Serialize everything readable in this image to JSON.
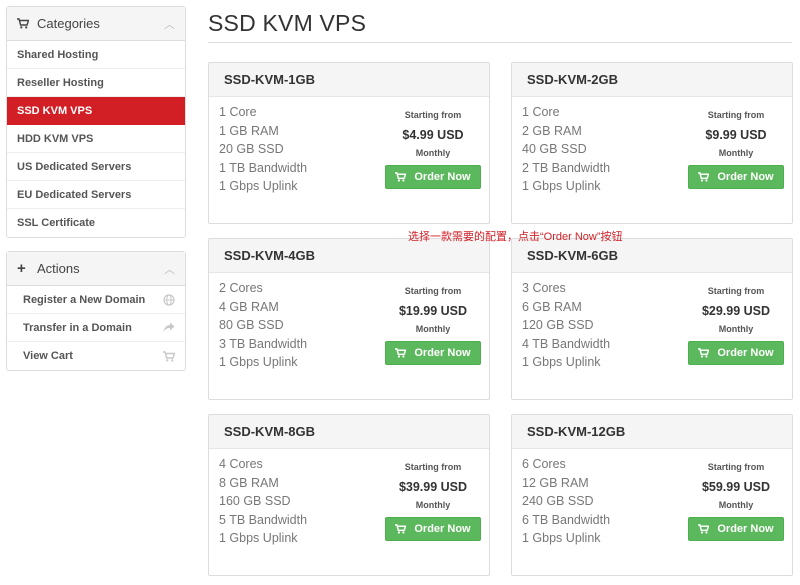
{
  "categories": {
    "title": "Categories",
    "items": [
      {
        "label": "Shared Hosting",
        "active": false
      },
      {
        "label": "Reseller Hosting",
        "active": false
      },
      {
        "label": "SSD KVM VPS",
        "active": true
      },
      {
        "label": "HDD KVM VPS",
        "active": false
      },
      {
        "label": "US Dedicated Servers",
        "active": false
      },
      {
        "label": "EU Dedicated Servers",
        "active": false
      },
      {
        "label": "SSL Certificate",
        "active": false
      }
    ]
  },
  "actions": {
    "title": "Actions",
    "items": [
      {
        "label": "Register a New Domain",
        "icon": "globe-icon"
      },
      {
        "label": "Transfer in a Domain",
        "icon": "share-arrow-icon"
      },
      {
        "label": "View Cart",
        "icon": "cart-icon"
      }
    ]
  },
  "page_title": "SSD KVM VPS",
  "annotation": "选择一款需要的配置，点击“Order Now”按钮",
  "products": [
    {
      "name": "SSD-KVM-1GB",
      "specs": [
        [
          "1",
          "Core"
        ],
        [
          "1 GB",
          "RAM"
        ],
        [
          "20 GB",
          "SSD"
        ],
        [
          "1 TB",
          "Bandwidth"
        ],
        [
          "1 Gbps",
          "Uplink"
        ]
      ],
      "starting": "Starting from",
      "price": "$4.99 USD",
      "cycle": "Monthly",
      "button": "Order Now"
    },
    {
      "name": "SSD-KVM-2GB",
      "specs": [
        [
          "1",
          "Core"
        ],
        [
          "2 GB",
          "RAM"
        ],
        [
          "40 GB",
          "SSD"
        ],
        [
          "2 TB",
          "Bandwidth"
        ],
        [
          "1 Gbps",
          "Uplink"
        ]
      ],
      "starting": "Starting from",
      "price": "$9.99 USD",
      "cycle": "Monthly",
      "button": "Order Now"
    },
    {
      "name": "SSD-KVM-4GB",
      "specs": [
        [
          "2",
          "Cores"
        ],
        [
          "4 GB",
          "RAM"
        ],
        [
          "80 GB",
          "SSD"
        ],
        [
          "3 TB",
          "Bandwidth"
        ],
        [
          "1 Gbps",
          "Uplink"
        ]
      ],
      "starting": "Starting from",
      "price": "$19.99 USD",
      "cycle": "Monthly",
      "button": "Order Now"
    },
    {
      "name": "SSD-KVM-6GB",
      "specs": [
        [
          "3",
          "Cores"
        ],
        [
          "6 GB",
          "RAM"
        ],
        [
          "120 GB",
          "SSD"
        ],
        [
          "4 TB",
          "Bandwidth"
        ],
        [
          "1 Gbps",
          "Uplink"
        ]
      ],
      "starting": "Starting from",
      "price": "$29.99 USD",
      "cycle": "Monthly",
      "button": "Order Now"
    },
    {
      "name": "SSD-KVM-8GB",
      "specs": [
        [
          "4",
          "Cores"
        ],
        [
          "8 GB",
          "RAM"
        ],
        [
          "160 GB",
          "SSD"
        ],
        [
          "5 TB",
          "Bandwidth"
        ],
        [
          "1 Gbps",
          "Uplink"
        ]
      ],
      "starting": "Starting from",
      "price": "$39.99 USD",
      "cycle": "Monthly",
      "button": "Order Now"
    },
    {
      "name": "SSD-KVM-12GB",
      "specs": [
        [
          "6",
          "Cores"
        ],
        [
          "12 GB",
          "RAM"
        ],
        [
          "240 GB",
          "SSD"
        ],
        [
          "6 TB",
          "Bandwidth"
        ],
        [
          "1 Gbps",
          "Uplink"
        ]
      ],
      "starting": "Starting from",
      "price": "$59.99 USD",
      "cycle": "Monthly",
      "button": "Order Now"
    }
  ],
  "colors": {
    "active": "#d21f26",
    "order_button": "#5cb85c",
    "annotation": "#d21f26"
  }
}
